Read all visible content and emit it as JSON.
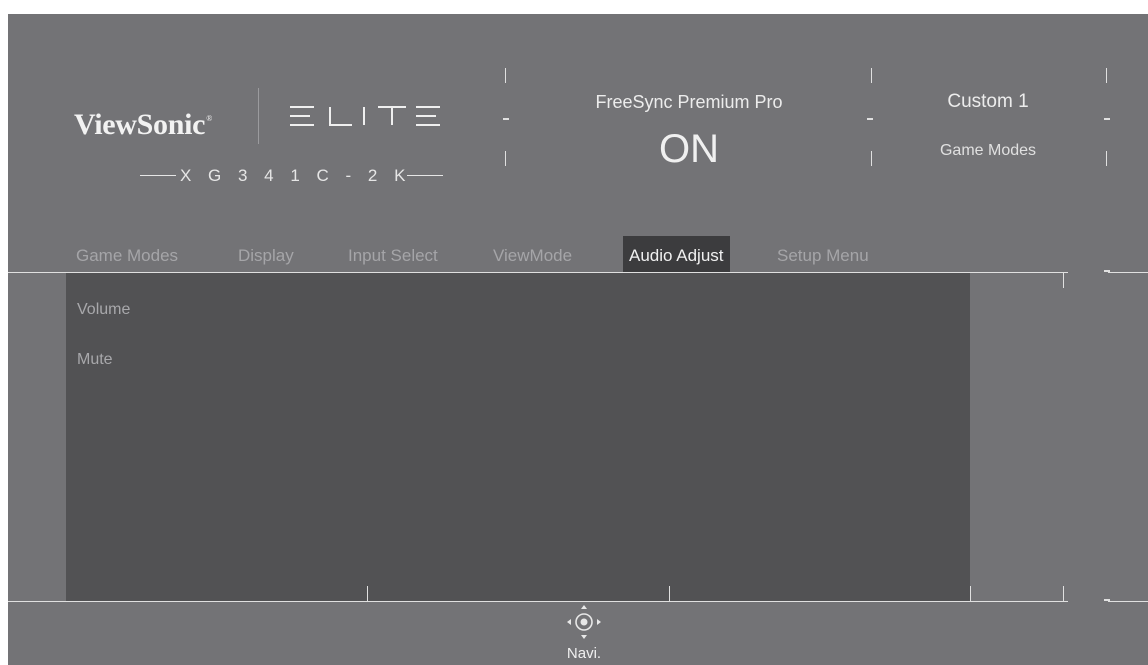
{
  "header": {
    "brand": "ViewSonic",
    "brand_mark": "®",
    "product_line": "ELITE",
    "model": "X G 3 4 1 C - 2 K"
  },
  "status": {
    "freesync_label": "FreeSync Premium Pro",
    "freesync_value": "ON",
    "game_mode_value": "Custom 1",
    "game_mode_label": "Game Modes"
  },
  "tabs": [
    {
      "label": "Game Modes",
      "active": false
    },
    {
      "label": "Display",
      "active": false
    },
    {
      "label": "Input Select",
      "active": false
    },
    {
      "label": "ViewMode",
      "active": false
    },
    {
      "label": "Audio Adjust",
      "active": true
    },
    {
      "label": "Setup Menu",
      "active": false
    }
  ],
  "menu": {
    "items": [
      {
        "label": "Volume"
      },
      {
        "label": "Mute"
      }
    ]
  },
  "footer": {
    "navi_icon": "joystick-navigation-icon",
    "navi_label": "Navi."
  }
}
